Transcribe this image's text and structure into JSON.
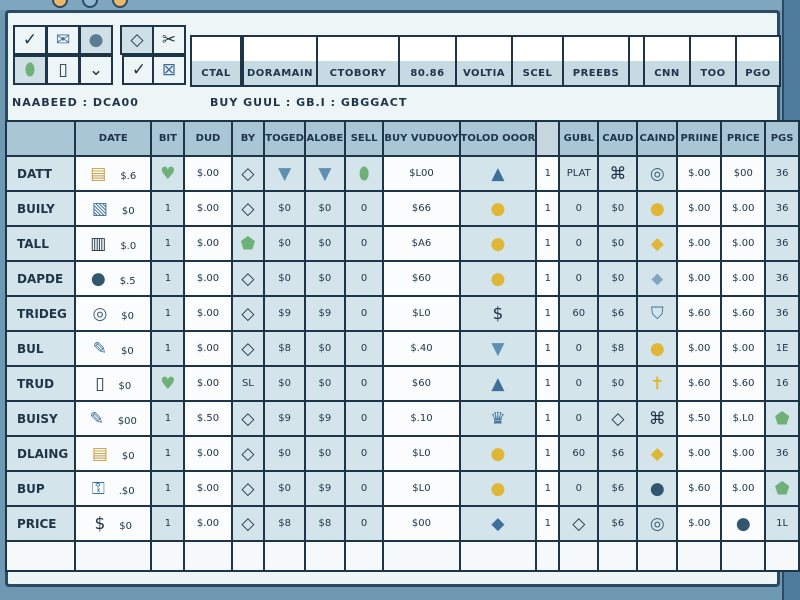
{
  "colors": {
    "accent": "#1e3448",
    "header": "#a9c6d4",
    "cell": "#d3e4ea",
    "coin": "#e0b636",
    "gem": "#6fb07a"
  },
  "toolbar": {
    "buttons": [
      "check-icon",
      "mail-icon",
      "circle-icon",
      "pill-icon",
      "document-icon",
      "chevron-down-icon"
    ],
    "buttons2": [
      "diamond-icon",
      "scissors-icon",
      "check-icon",
      "close-box-icon"
    ]
  },
  "column_tabs": [
    "CTAL",
    "DORAMAIN",
    "CTOBORY",
    "80.86",
    "VOLTIA",
    "SCEL",
    "PREEBS",
    "",
    "CNN",
    "TOO",
    "PGO"
  ],
  "status": {
    "left": "NAABEED : DCA00",
    "right": "BUY GUUL : GB.I : GBGGACT"
  },
  "table": {
    "headers": [
      "",
      "DATE",
      "BIT",
      "DUD",
      "BY",
      "TOGED",
      "ALOBE",
      "SELL",
      "BUY VUDUOY",
      "TOLOD OOOR",
      "",
      "GUBL",
      "CAUD",
      "CAIND",
      "PRIINE",
      "PRICE",
      "PGS"
    ],
    "rows": [
      [
        "DATT",
        [
          "ticket-icon",
          "$.6"
        ],
        {
          "i": "heart-icon"
        },
        "$.00",
        {
          "i": "diamond-icon"
        },
        {
          "i": "triangle-down-icon"
        },
        {
          "i": "triangle-down-icon"
        },
        {
          "i": "pill-icon"
        },
        "$L00",
        {
          "i": "triangle-up-icon"
        },
        "1",
        "PLAT",
        {
          "i": "knot-icon"
        },
        {
          "i": "coin-outline-icon"
        },
        "$.00",
        "$00",
        "36"
      ],
      [
        "BUILY",
        [
          "map-icon",
          "$0"
        ],
        "1",
        "$.00",
        {
          "i": "diamond-icon"
        },
        "$0",
        "$0",
        "0",
        "$66",
        {
          "i": "coin-icon"
        },
        "1",
        "0",
        "$0",
        {
          "i": "coin-icon"
        },
        "$.00",
        "$.00",
        "36"
      ],
      [
        "TALL",
        [
          "barcode-icon",
          "$.0"
        ],
        "1",
        "$.00",
        {
          "i": "gem-icon"
        },
        "$0",
        "$0",
        "0",
        "$A6",
        {
          "i": "coin-icon"
        },
        "1",
        "0",
        "$0",
        {
          "i": "gold-diamond-icon"
        },
        "$.00",
        "$.00",
        "36"
      ],
      [
        "DAPDE",
        [
          "dark-coin-icon",
          "$.5"
        ],
        "1",
        "$.00",
        {
          "i": "diamond-icon"
        },
        "$0",
        "$0",
        "0",
        "$60",
        {
          "i": "coin-icon"
        },
        "1",
        "0",
        "$0",
        {
          "i": "flat-gem-icon"
        },
        "$.00",
        "$.00",
        "36"
      ],
      [
        "TRIDEG",
        [
          "coin-outline-icon",
          "$0"
        ],
        "1",
        "$.00",
        {
          "i": "diamond-icon"
        },
        "$9",
        "$9",
        "0",
        "$L0",
        {
          "i": "dollar-icon"
        },
        "1",
        "60",
        "$6",
        {
          "i": "shield-icon"
        },
        "$.60",
        "$.60",
        "36"
      ],
      [
        "BUL",
        [
          "pen-icon",
          "$0"
        ],
        "1",
        "$.00",
        {
          "i": "diamond-icon"
        },
        "$8",
        "$0",
        "0",
        "$.40",
        {
          "i": "triangle-down-icon"
        },
        "1",
        "0",
        "$8",
        {
          "i": "coin-icon"
        },
        "$.00",
        "$.00",
        "1E"
      ],
      [
        "TRUD",
        [
          "document-icon",
          "$0"
        ],
        {
          "i": "heart-icon"
        },
        "$.00",
        "SL",
        "$0",
        "$0",
        "0",
        "$60",
        {
          "i": "triangle-up-icon"
        },
        "1",
        "0",
        "$0",
        {
          "i": "cross-icon"
        },
        "$.60",
        "$.60",
        "16"
      ],
      [
        "BUISY",
        [
          "pen-icon",
          "$00"
        ],
        "1",
        "$.50",
        {
          "i": "diamond-icon"
        },
        "$9",
        "$9",
        "0",
        "$.10",
        {
          "i": "crown-icon"
        },
        "1",
        "0",
        {
          "i": "diamond-icon"
        },
        {
          "i": "knot-icon"
        },
        "$.50",
        "$.L0",
        {
          "i": "gem-icon"
        }
      ],
      [
        "DLAING",
        [
          "ticket-icon",
          "$0"
        ],
        "1",
        "$.00",
        {
          "i": "diamond-icon"
        },
        "$0",
        "$0",
        "0",
        "$L0",
        {
          "i": "coin-icon"
        },
        "1",
        "60",
        "$6",
        {
          "i": "gold-diamond-icon"
        },
        "$.00",
        "$.00",
        "36"
      ],
      [
        "BUP",
        [
          "key-icon",
          ".$0"
        ],
        "1",
        "$.00",
        {
          "i": "diamond-icon"
        },
        "$0",
        "$9",
        "0",
        "$L0",
        {
          "i": "coin-icon"
        },
        "1",
        "0",
        "$6",
        {
          "i": "dark-coin-icon"
        },
        "$.60",
        "$.00",
        {
          "i": "gem-icon"
        }
      ],
      [
        "PRICE",
        [
          "dollar-icon",
          "$0"
        ],
        "1",
        "$.00",
        {
          "i": "diamond-icon"
        },
        "$8",
        "$8",
        "0",
        "$00",
        {
          "i": "blue-diamond-icon"
        },
        "1",
        {
          "i": "diamond-icon"
        },
        "$6",
        {
          "i": "coin-outline-icon"
        },
        "$.00",
        {
          "i": "dark-coin-icon"
        },
        "1L"
      ]
    ]
  }
}
